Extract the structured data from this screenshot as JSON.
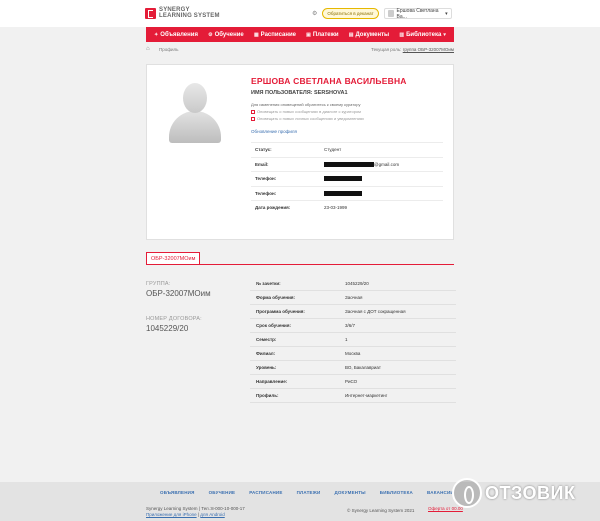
{
  "header": {
    "logo_line1": "SYNERGY",
    "logo_line2": "LEARNING SYSTEM",
    "support_label": "Обратиться в деканат",
    "user_name": "Ершова Светлана Ва..."
  },
  "nav": {
    "items": [
      {
        "label": "Объявления",
        "icon": "megaphone-icon"
      },
      {
        "label": "Обучение",
        "icon": "gear-icon"
      },
      {
        "label": "Расписание",
        "icon": "schedule-icon"
      },
      {
        "label": "Платежи",
        "icon": "payment-icon"
      },
      {
        "label": "Документы",
        "icon": "document-icon"
      },
      {
        "label": "Библиотека",
        "icon": "library-icon"
      }
    ]
  },
  "breadcrumb": {
    "current": "Профиль",
    "role_prefix": "Текущая роль:",
    "role_value": "группа ОБР-32007МОим"
  },
  "profile": {
    "full_name": "ЕРШОВА СВЕТЛАНА ВАСИЛЬЕВНА",
    "username_line": "ИМЯ ПОЛЬЗОВАТЕЛЯ: SERSHOVA1",
    "notify_note": "Для изменения оповещений обратитесь к своему куратору",
    "notify_options": [
      "Оповещать о новых сообщениях в диалоге с куратором",
      "Оповещать о новых личных сообщениях и уведомлениях"
    ],
    "edit_link": "Обновление профиля",
    "fields": [
      {
        "key": "Статус:",
        "value": "Студент"
      },
      {
        "key": "Email:",
        "value": "@gmail.com"
      },
      {
        "key": "Телефон:",
        "value": ""
      },
      {
        "key": "Телефон:",
        "value": ""
      },
      {
        "key": "Дата рождения:",
        "value": "23-03-1999"
      }
    ]
  },
  "tab": {
    "label": "ОБР-32007МОим"
  },
  "education": {
    "group_label": "ГРУППА:",
    "group_value": "ОБР-32007МОим",
    "contract_label": "НОМЕР ДОГОВОРА:",
    "contract_value": "1045229/20",
    "rows": [
      {
        "key": "№ зачетки:",
        "value": "1045229/20"
      },
      {
        "key": "Форма обучения:",
        "value": "Заочная"
      },
      {
        "key": "Программа обучения:",
        "value": "Заочная с ДОТ сокращенная"
      },
      {
        "key": "Срок обучения:",
        "value": "3/6/7"
      },
      {
        "key": "Семестр:",
        "value": "1"
      },
      {
        "key": "Филиал:",
        "value": "Москва"
      },
      {
        "key": "Уровень:",
        "value": "ВО, Бакалавриат"
      },
      {
        "key": "Направление:",
        "value": "РиСО"
      },
      {
        "key": "Профиль:",
        "value": "Интернет-маркетинг"
      }
    ]
  },
  "footer": {
    "nav": [
      "ОБЪЯВЛЕНИЯ",
      "ОБУЧЕНИЕ",
      "РАСПИСАНИЕ",
      "ПЛАТЕЖИ",
      "ДОКУМЕНТЫ",
      "БИБЛИОТЕКА",
      "ВАКАНСИИ"
    ],
    "brand": "Synergy Learning System",
    "phone": "Тел.:8-000-10-000-17",
    "app_ios": "Приложение для iPhone",
    "app_android": "для Android",
    "copyright": "© Synergy Learning System 2021",
    "privacy": "Оферта от 00.00"
  },
  "watermark": {
    "text": "ОТЗОВИК"
  },
  "colors": {
    "accent": "#e41c38",
    "link": "#3a6fb0",
    "background": "#f1f1f1"
  }
}
